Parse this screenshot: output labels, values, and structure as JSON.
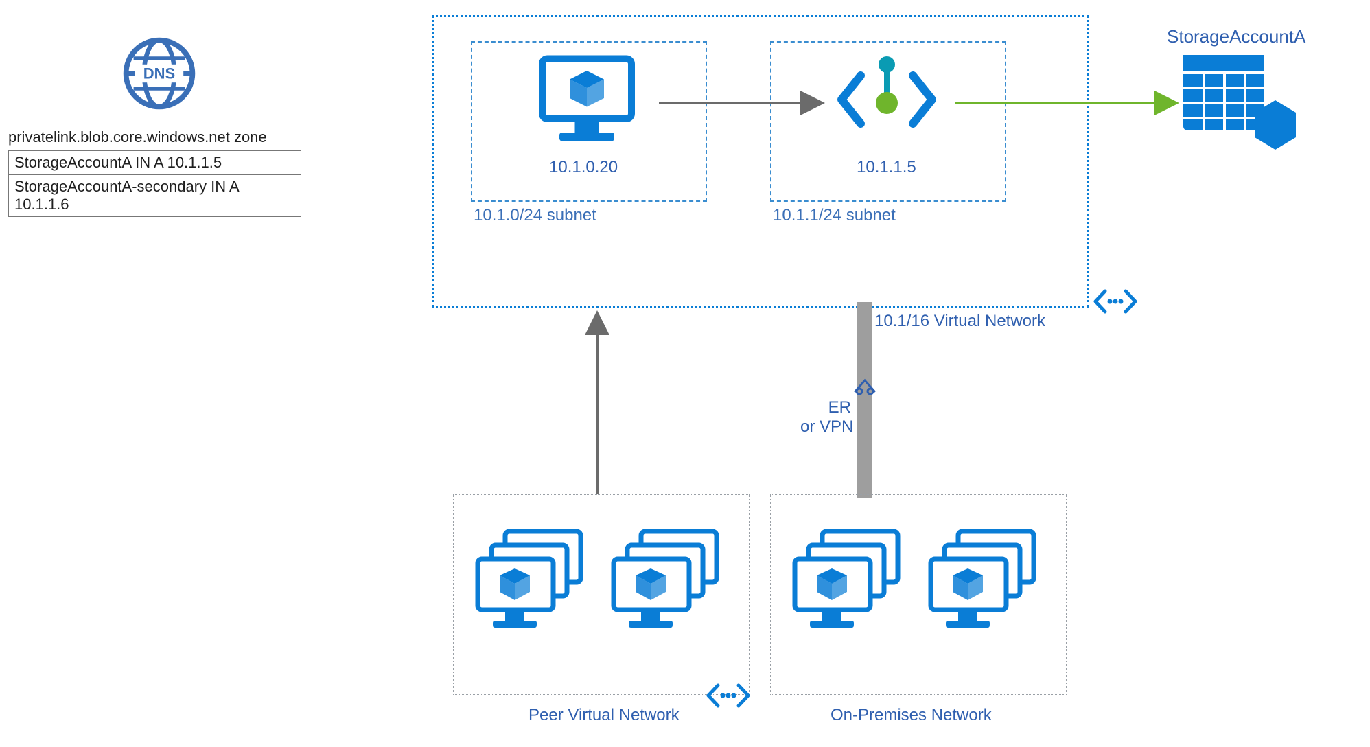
{
  "dns": {
    "zone_label": "privatelink.blob.core.windows.net zone",
    "records": [
      "StorageAccountA IN A 10.1.1.5",
      "StorageAccountA-secondary IN A 10.1.1.6"
    ]
  },
  "vnet": {
    "label": "10.1/16 Virtual Network",
    "subnet_a": {
      "label": "10.1.0/24 subnet",
      "vm_ip": "10.1.0.20"
    },
    "subnet_b": {
      "label": "10.1.1/24 subnet",
      "endpoint_ip": "10.1.1.5"
    }
  },
  "storage": {
    "title": "StorageAccountA"
  },
  "peer": {
    "label": "Peer Virtual Network"
  },
  "onprem": {
    "label": "On-Premises Network",
    "link": "ER\nor VPN"
  },
  "colors": {
    "azure_blue": "#0a7dd6",
    "label_blue": "#2f5faf",
    "green": "#6fb52c",
    "teal": "#0a9bb3",
    "gray_arrow": "#6b6b6b"
  }
}
